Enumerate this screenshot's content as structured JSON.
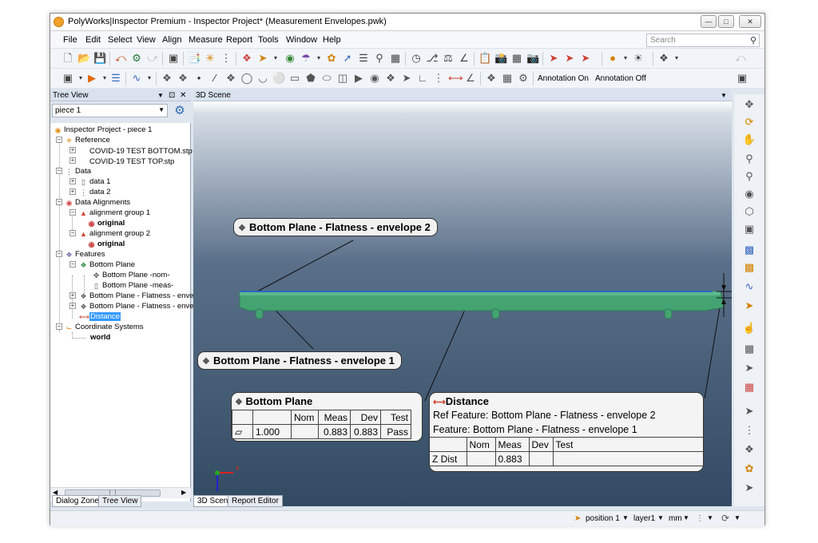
{
  "window": {
    "title": "PolyWorks|Inspector Premium - Inspector Project* (Measurement Envelopes.pwk)"
  },
  "menu": [
    "File",
    "Edit",
    "Select",
    "View",
    "Align",
    "Measure",
    "Report",
    "Tools",
    "Window",
    "Help"
  ],
  "search": {
    "placeholder": "Search"
  },
  "toolbar": {
    "annotation_on": "Annotation On",
    "annotation_off": "Annotation Off"
  },
  "tree_view": {
    "title": "Tree View",
    "piece_select": "piece 1",
    "items": [
      {
        "label": "Inspector Project - piece 1",
        "icon": "polyworks-icon"
      },
      {
        "label": "Reference",
        "icon": "reference-icon"
      },
      {
        "label": "COVID-19 TEST BOTTOM.stp",
        "icon": "cad-icon"
      },
      {
        "label": "COVID-19 TEST TOP.stp",
        "icon": "cad-icon"
      },
      {
        "label": "Data",
        "icon": "data-icon"
      },
      {
        "label": "data 1",
        "icon": "data-object-icon"
      },
      {
        "label": "data 2",
        "icon": "data-object-icon"
      },
      {
        "label": "Data Alignments",
        "icon": "alignment-icon"
      },
      {
        "label": "alignment group 1",
        "icon": "alignment-group-icon"
      },
      {
        "label": "original",
        "icon": "alignment-icon"
      },
      {
        "label": "alignment group 2",
        "icon": "alignment-group-icon"
      },
      {
        "label": "original",
        "icon": "alignment-icon"
      },
      {
        "label": "Features",
        "icon": "features-icon"
      },
      {
        "label": "Bottom Plane",
        "icon": "plane-feature-icon"
      },
      {
        "label": "Bottom Plane -nom-",
        "icon": "nominal-icon"
      },
      {
        "label": "Bottom Plane -meas-",
        "icon": "measured-icon"
      },
      {
        "label": "Bottom Plane - Flatness - envel",
        "icon": "plane-feature-icon"
      },
      {
        "label": "Bottom Plane - Flatness - envel",
        "icon": "plane-feature-icon"
      },
      {
        "label": "Distance",
        "icon": "distance-icon"
      },
      {
        "label": "Coordinate Systems",
        "icon": "coordinate-icon"
      },
      {
        "label": "world",
        "icon": ""
      }
    ]
  },
  "scene": {
    "title": "3D Scene",
    "labels": {
      "envelope2": "Bottom Plane - Flatness - envelope 2",
      "envelope1": "Bottom Plane - Flatness - envelope 1"
    },
    "bottom_plane_card": {
      "title": "Bottom Plane",
      "headers": [
        "",
        "",
        "Nom",
        "Meas",
        "Dev",
        "Test"
      ],
      "row": {
        "icon": "flatness-icon",
        "tol": "1.000",
        "nom": "",
        "meas": "0.883",
        "dev": "0.883",
        "test": "Pass"
      }
    },
    "distance_card": {
      "title": "Distance",
      "ref_feature": "Ref Feature: Bottom Plane - Flatness - envelope 2",
      "feature": "Feature: Bottom Plane - Flatness - envelope 1",
      "headers": [
        "",
        "Nom",
        "Meas",
        "Dev",
        "Test"
      ],
      "row": {
        "name": "Z Dist",
        "nom": "",
        "meas": "0.883",
        "dev": "",
        "test": ""
      }
    },
    "axes": {
      "x": "x",
      "z": "z"
    }
  },
  "bottom_tabs_left": [
    "Dialog Zone",
    "Tree View"
  ],
  "bottom_tabs_right": [
    "3D Scene",
    "Report Editor"
  ],
  "status": {
    "position": "position 1",
    "layer": "layer1",
    "units": "mm"
  },
  "colors": {
    "part": "#3f9e6e",
    "envelope": "#2b63c6",
    "scene_bottom": "#324a62"
  }
}
